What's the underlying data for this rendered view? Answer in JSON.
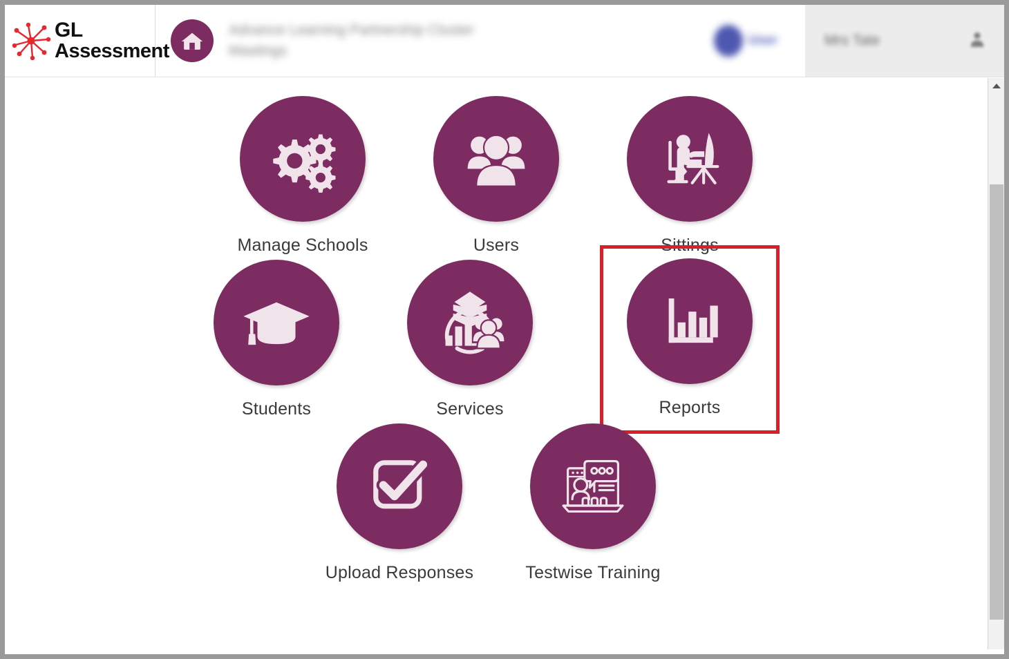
{
  "app": {
    "brand_line1": "GL",
    "brand_line2": "Assessment",
    "brand_logo_icon": "starburst-icon",
    "brand_logo_color": "#e8262d",
    "accent_purple": "#7c2c60",
    "highlight_color": "#d8202a"
  },
  "header": {
    "home_icon": "home-icon",
    "title_line1": "Advance Learning Partnership Cluster",
    "title_line2": "Mastings",
    "title_redacted": true,
    "user_chip_label": "User",
    "user_chip_redacted": true,
    "account_name": "Mrs Tate",
    "account_name_redacted": true,
    "account_icon": "person-icon"
  },
  "tiles": {
    "rows": [
      [
        {
          "id": "manage-schools",
          "label": "Manage Schools",
          "icon": "gears-icon",
          "highlighted": false
        },
        {
          "id": "users",
          "label": "Users",
          "icon": "people-group-icon",
          "highlighted": false
        },
        {
          "id": "sittings",
          "label": "Sittings",
          "icon": "person-at-desk-icon",
          "highlighted": false
        }
      ],
      [
        {
          "id": "students",
          "label": "Students",
          "icon": "graduation-cap-icon",
          "highlighted": false
        },
        {
          "id": "services",
          "label": "Services",
          "icon": "services-chart-people-icon",
          "highlighted": false
        },
        {
          "id": "reports",
          "label": "Reports",
          "icon": "bar-chart-icon",
          "highlighted": true
        }
      ],
      [
        {
          "id": "upload-responses",
          "label": "Upload Responses",
          "icon": "checkbox-tick-icon",
          "highlighted": false
        },
        {
          "id": "testwise-training",
          "label": "Testwise Training",
          "icon": "laptop-webinar-icon",
          "highlighted": false
        }
      ]
    ]
  },
  "scrollbar": {
    "up_arrow_icon": "chevron-up-icon",
    "down_arrow_icon": "chevron-down-icon",
    "orientation": "vertical"
  }
}
